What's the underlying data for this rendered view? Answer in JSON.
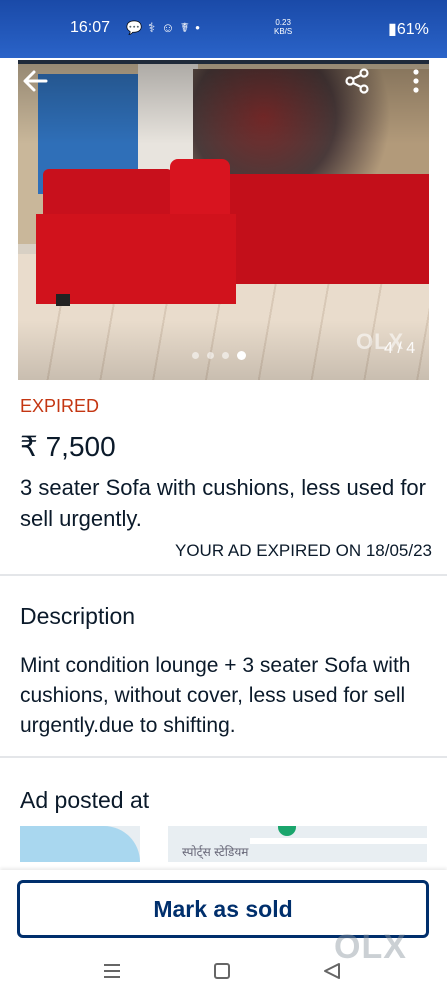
{
  "status_bar": {
    "time": "16:07",
    "net_rate_value": "0.23",
    "net_rate_unit": "KB/S",
    "battery": "61%"
  },
  "gallery": {
    "counter": "4 / 4",
    "total_images": 4,
    "current_index": 4,
    "watermark": "OLX"
  },
  "listing": {
    "status": "EXPIRED",
    "price": "₹ 7,500",
    "title": "3 seater Sofa with cushions, less used for sell urgently.",
    "expiry_note": "YOUR AD EXPIRED ON 18/05/23"
  },
  "description": {
    "heading": "Description",
    "text": "Mint condition lounge + 3 seater Sofa with cushions, without cover, less used for sell urgently.due to shifting."
  },
  "location": {
    "heading": "Ad posted at",
    "map_label_top": "स्पोर्ट्स स्टेडियम",
    "map_label": "स्पोर्ट्स स्टेडियम"
  },
  "actions": {
    "mark_sold_label": "Mark as sold"
  },
  "colors": {
    "primary": "#002f6c",
    "expired": "#c43612",
    "status_bar": "#2a63c8"
  }
}
